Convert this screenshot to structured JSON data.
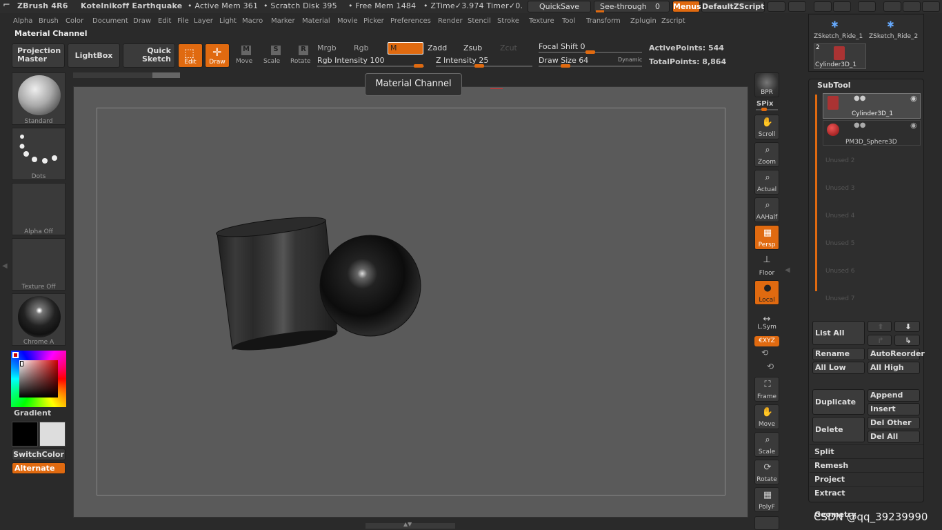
{
  "titlebar": {
    "app": "ZBrush 4R6",
    "project": "Kotelnikoff Earthquake",
    "active_mem": "• Active Mem 361",
    "scratch": "• Scratch Disk 395",
    "free_mem": "• Free Mem 1484",
    "ztime": "• ZTime✓3.974 Timer✓0.",
    "quicksave": "QuickSave",
    "seethrough": "See-through",
    "seethrough_val": "0",
    "menus": "Menus",
    "script": "DefaultZScript"
  },
  "menu": [
    "Alpha",
    "Brush",
    "Color",
    "Document",
    "Draw",
    "Edit",
    "File",
    "Layer",
    "Light",
    "Macro",
    "Marker",
    "Material",
    "Movie",
    "Picker",
    "Preferences",
    "Render",
    "Stencil",
    "Stroke",
    "Texture",
    "Tool",
    "Transform",
    "Zplugin",
    "Zscript"
  ],
  "toolbar": {
    "title": "Material Channel",
    "projection": "Projection Master",
    "lightbox": "LightBox",
    "quicksketch": "Quick Sketch",
    "edit": "Edit",
    "draw": "Draw",
    "move": "Move",
    "scale": "Scale",
    "rotate": "Rotate",
    "mrgb": "Mrgb",
    "rgb": "Rgb",
    "m": "M",
    "zadd": "Zadd",
    "zsub": "Zsub",
    "zcut": "Zcut",
    "rgb_intensity": "Rgb Intensity 100",
    "z_intensity": "Z Intensity 25",
    "focal_shift": "Focal Shift 0",
    "draw_size": "Draw Size 64",
    "dynamic": "Dynamic",
    "active_points": "ActivePoints: 544",
    "total_points": "TotalPoints: 8,864",
    "tooltip": "Material Channel"
  },
  "left": {
    "standard": "Standard",
    "dots": "Dots",
    "alpha": "Alpha Off",
    "texture": "Texture Off",
    "material": "Chrome A",
    "gradient": "Gradient",
    "switchcolor": "SwitchColor",
    "alternate": "Alternate"
  },
  "right": {
    "bpr": "BPR",
    "spix": "SPix",
    "scroll": "Scroll",
    "zoom": "Zoom",
    "actual": "Actual",
    "aahalf": "AAHalf",
    "persp": "Persp",
    "floor": "Floor",
    "local": "Local",
    "lsym": "L.Sym",
    "xyz": "€XYZ",
    "frame": "Frame",
    "move": "Move",
    "scale": "Scale",
    "rotate": "Rotate",
    "polyf": "PolyF"
  },
  "tool_thumbs": {
    "t1": "ZSketch_Ride_1",
    "t2": "ZSketch_Ride_2",
    "t3": "Cylinder3D_1",
    "t3_num": "2"
  },
  "subtool": {
    "title": "SubTool",
    "items": [
      "Cylinder3D_1",
      "PM3D_Sphere3D"
    ],
    "unused": [
      "Unused 2",
      "Unused 3",
      "Unused 4",
      "Unused 5",
      "Unused 6",
      "Unused 7"
    ],
    "listall": "List All",
    "rename": "Rename",
    "autoreorder": "AutoReorder",
    "alllow": "All Low",
    "allhigh": "All High",
    "duplicate": "Duplicate",
    "append": "Append",
    "insert": "Insert",
    "delete": "Delete",
    "delother": "Del Other",
    "delall": "Del All",
    "split": "Split",
    "remesh": "Remesh",
    "project": "Project",
    "extract": "Extract",
    "geometry": "Geometry"
  },
  "watermark": "CSDN @qq_39239990",
  "colors": {
    "accent": "#e06a10"
  }
}
